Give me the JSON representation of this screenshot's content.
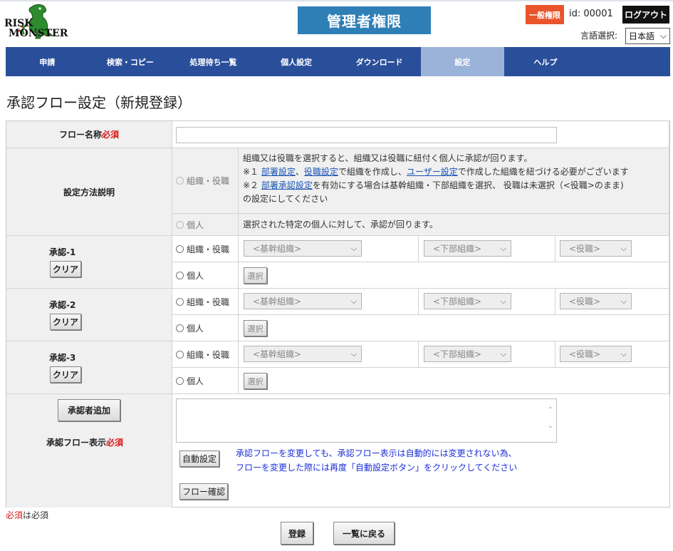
{
  "header": {
    "brand_line1": "RISK",
    "brand_line2": "MONSTER",
    "banner": "管理者権限",
    "perm_badge": "一般権限",
    "user_id": "id: 00001",
    "logout": "ログアウト",
    "lang_label": "言語選択:",
    "lang_value": "日本語"
  },
  "nav": [
    {
      "label": "申請"
    },
    {
      "label": "検索・コピー"
    },
    {
      "label": "処理待ち一覧"
    },
    {
      "label": "個人設定"
    },
    {
      "label": "ダウンロード"
    },
    {
      "label": "設定",
      "active": true
    },
    {
      "label": "ヘルプ"
    }
  ],
  "page_title": "承認フロー設定（新規登録）",
  "form": {
    "flow_name_label": "フロー名称",
    "required_mark": "必須",
    "flow_name_value": "",
    "method_label": "設定方法説明",
    "method_org_radio": "組織・役職",
    "method_person_radio": "個人",
    "method_org_desc_1": "組織又は役職を選択すると、組織又は役職に紐付く個人に承認が回ります。",
    "method_org_desc_2a": "※１ ",
    "method_org_desc_2_link1": "部署設定",
    "method_org_desc_2b": "、",
    "method_org_desc_2_link2": "役職設定",
    "method_org_desc_2c": "で組織を作成し、",
    "method_org_desc_2_link3": "ユーザー設定",
    "method_org_desc_2d": "で作成した組織を紐づける必要がございます",
    "method_org_desc_3a": "※２ ",
    "method_org_desc_3_link": "部署承認設定",
    "method_org_desc_3b": "を有効にする場合は基幹組織・下部組織を選択、 役職は未選択（<役職>のまま)",
    "method_org_desc_4": "の設定にしてください",
    "method_person_desc": "選択された特定の個人に対して、承認が回ります。",
    "approvals": [
      {
        "label": "承認-1",
        "clear": "クリア",
        "org_radio": "組織・役職",
        "person_radio": "個人",
        "main_org": "<基幹組織>",
        "sub_org": "<下部組織>",
        "position": "<役職>",
        "select_btn": "選択"
      },
      {
        "label": "承認-2",
        "clear": "クリア",
        "org_radio": "組織・役職",
        "person_radio": "個人",
        "main_org": "<基幹組織>",
        "sub_org": "<下部組織>",
        "position": "<役職>",
        "select_btn": "選択"
      },
      {
        "label": "承認-3",
        "clear": "クリア",
        "org_radio": "組織・役職",
        "person_radio": "個人",
        "main_org": "<基幹組織>",
        "sub_org": "<下部組織>",
        "position": "<役職>",
        "select_btn": "選択"
      }
    ],
    "add_approver": "承認者追加",
    "display_label": "承認フロー表示",
    "display_value": "",
    "auto_set": "自動設定",
    "auto_note_1": "承認フローを変更しても、承認フロー表示は自動的には変更されない為、",
    "auto_note_2": "フローを変更した際には再度「自動設定ボタン」をクリックしてください",
    "flow_confirm": "フロー確認"
  },
  "footer": {
    "required_word": "必須",
    "required_suffix": "は必須",
    "register": "登録",
    "back": "一覧に戻る"
  },
  "colors": {
    "nav_bg": "#2a4f9a",
    "nav_active": "#9cb3d9",
    "banner": "#2f7fb7",
    "badge": "#e8542b",
    "required": "#d61a1a",
    "note": "#1b2fd8"
  }
}
